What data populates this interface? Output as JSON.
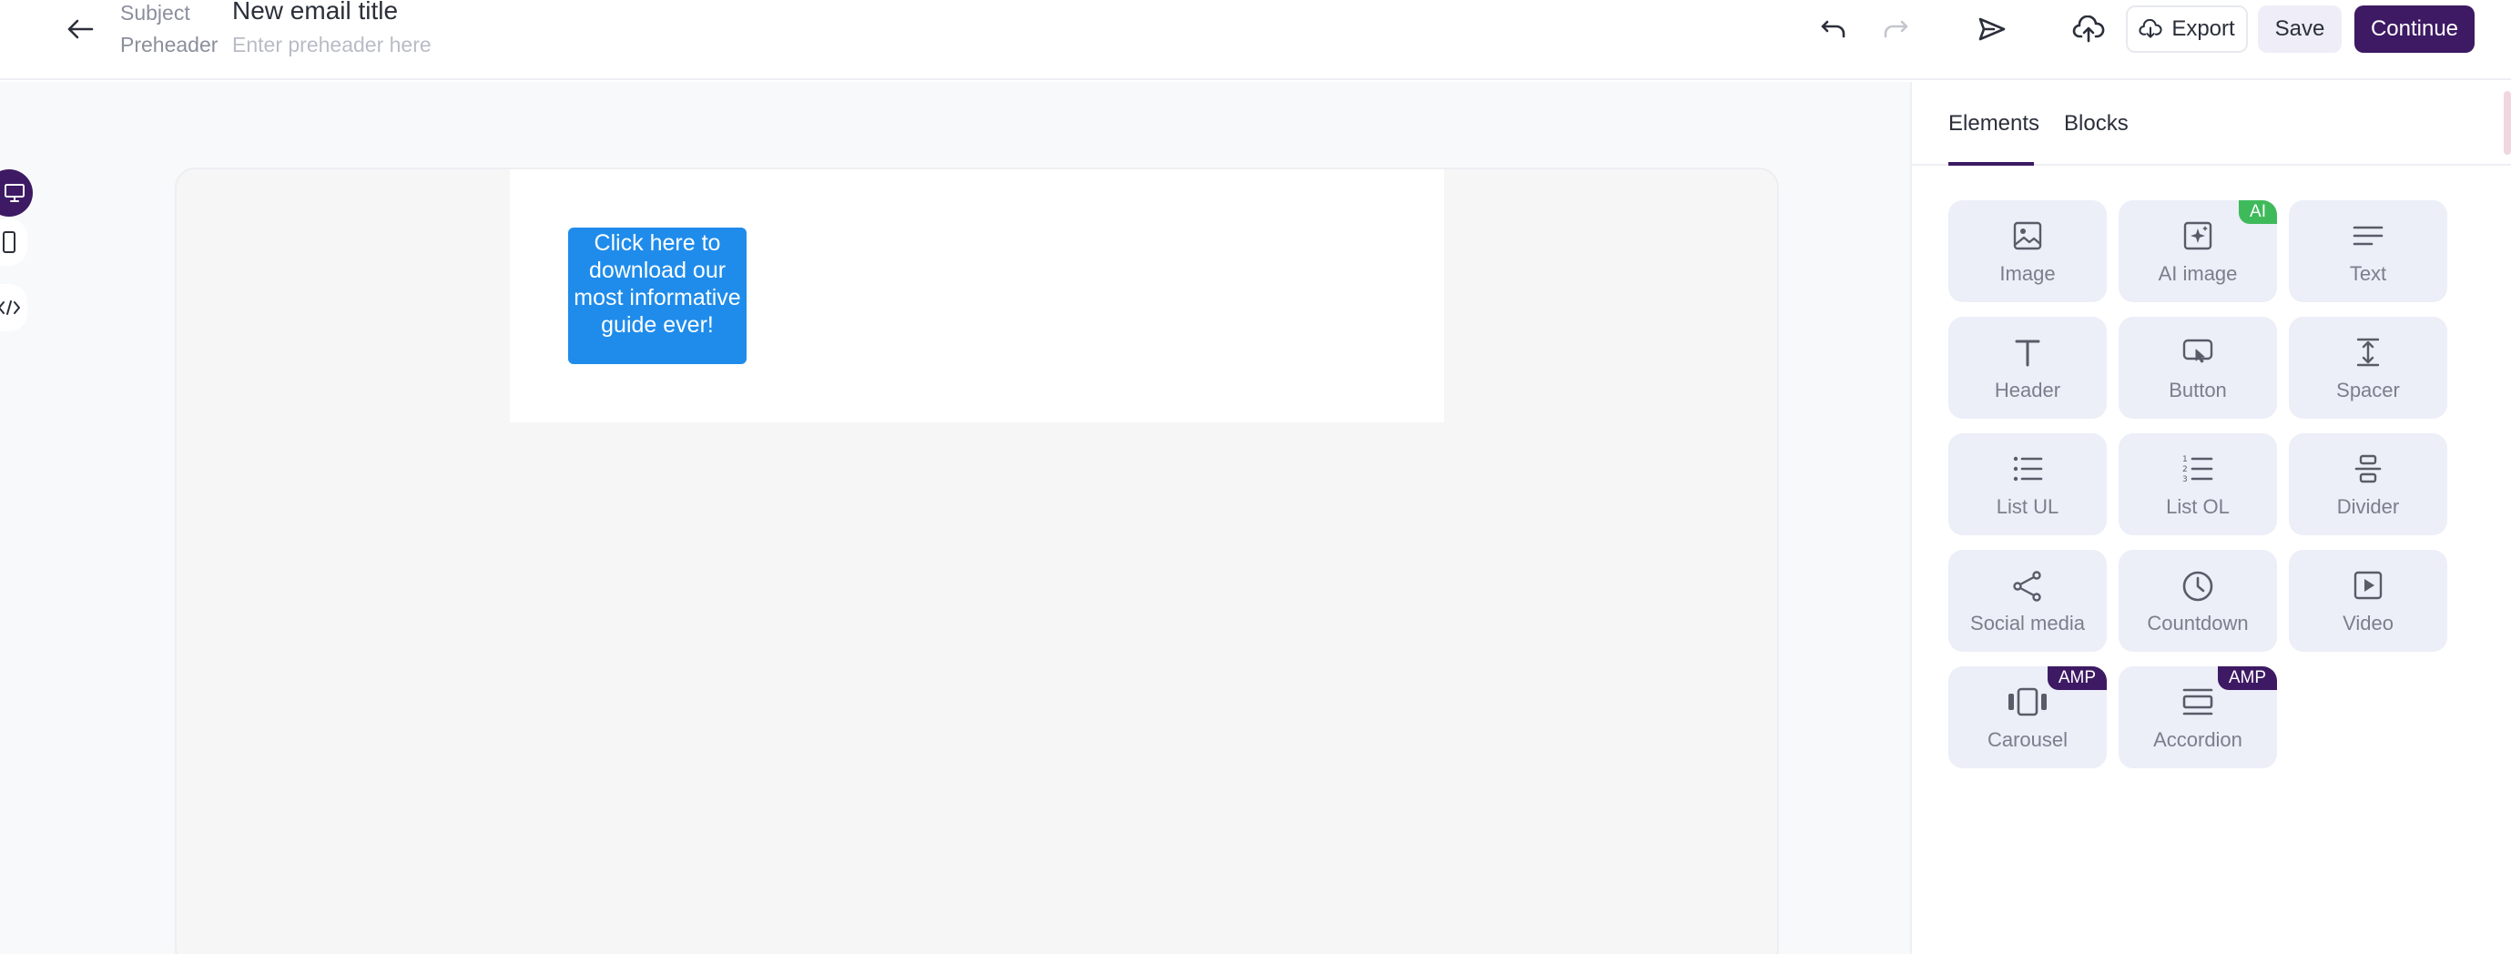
{
  "header": {
    "subject_label": "Subject",
    "subject_value": "New email title",
    "preheader_label": "Preheader",
    "preheader_placeholder": "Enter preheader here",
    "export_label": "Export",
    "save_label": "Save",
    "continue_label": "Continue"
  },
  "canvas": {
    "button_text": "Click here to download our most informative guide ever!"
  },
  "panel": {
    "tabs": [
      {
        "label": "Elements",
        "active": true
      },
      {
        "label": "Blocks",
        "active": false
      }
    ],
    "elements": [
      {
        "label": "Image",
        "icon": "image-icon"
      },
      {
        "label": "AI image",
        "icon": "ai-image-icon",
        "badge": "AI"
      },
      {
        "label": "Text",
        "icon": "text-icon"
      },
      {
        "label": "Header",
        "icon": "header-icon"
      },
      {
        "label": "Button",
        "icon": "button-icon"
      },
      {
        "label": "Spacer",
        "icon": "spacer-icon"
      },
      {
        "label": "List UL",
        "icon": "list-ul-icon"
      },
      {
        "label": "List OL",
        "icon": "list-ol-icon"
      },
      {
        "label": "Divider",
        "icon": "divider-icon"
      },
      {
        "label": "Social media",
        "icon": "social-media-icon"
      },
      {
        "label": "Countdown",
        "icon": "countdown-icon"
      },
      {
        "label": "Video",
        "icon": "video-icon"
      },
      {
        "label": "Carousel",
        "icon": "carousel-icon",
        "badge": "AMP"
      },
      {
        "label": "Accordion",
        "icon": "accordion-icon",
        "badge": "AMP"
      }
    ]
  },
  "colors": {
    "brand": "#3d1a63",
    "ai_badge": "#3fba5b",
    "canvas_button": "#1f8ceb",
    "tile_bg": "#eceef8"
  }
}
